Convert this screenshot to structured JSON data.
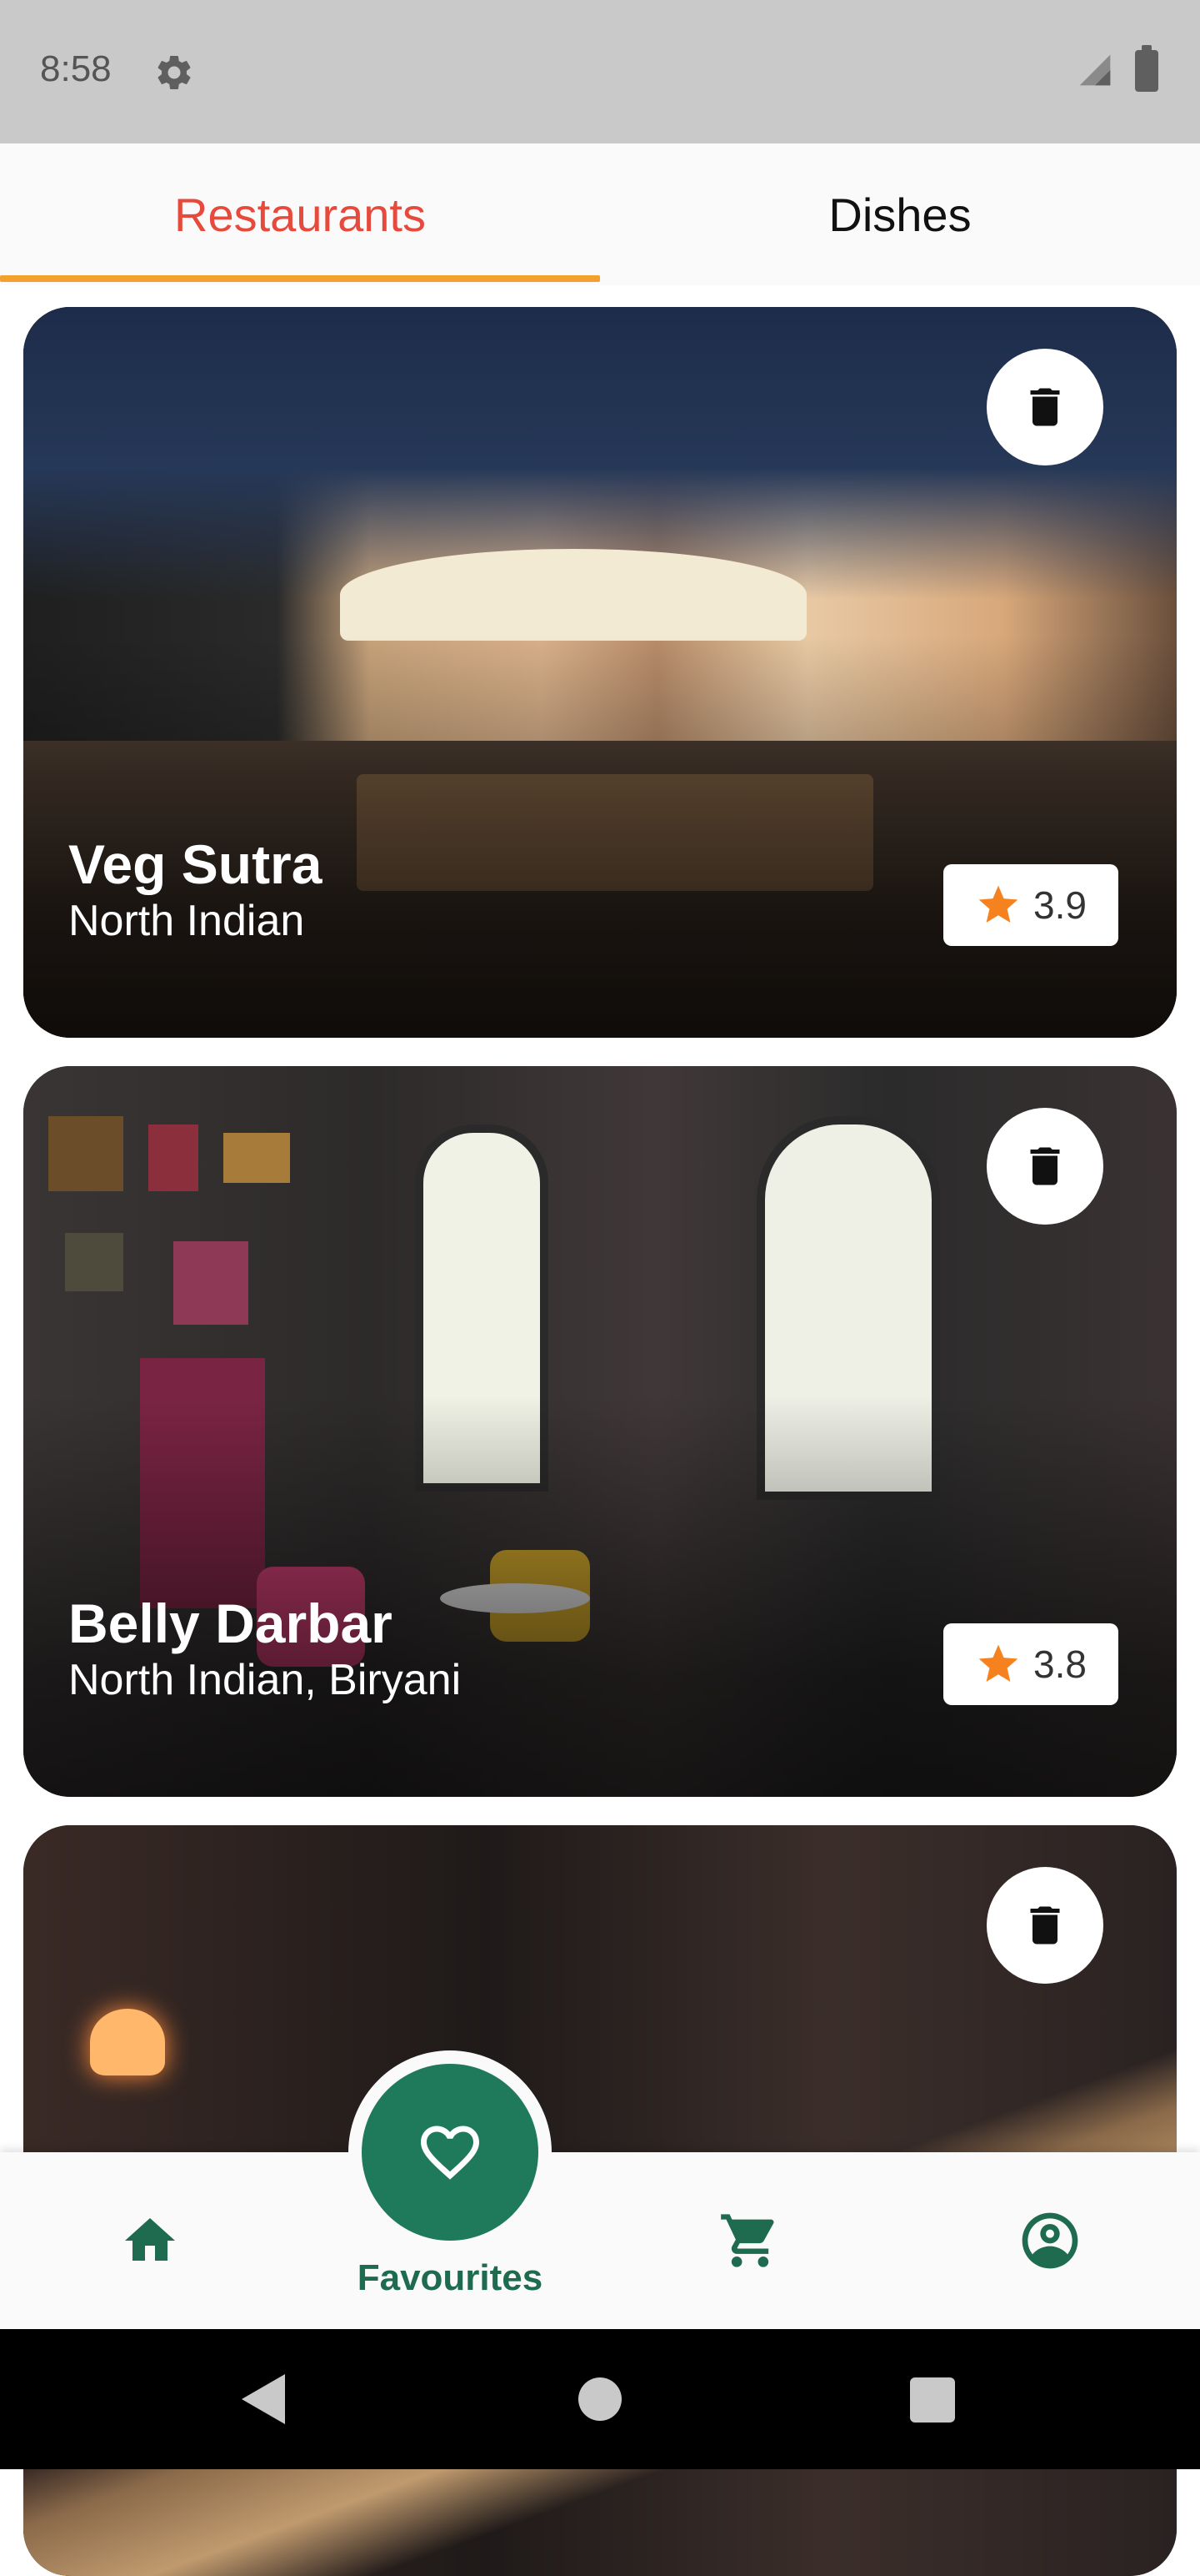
{
  "status_bar": {
    "time": "8:58"
  },
  "tabs": [
    {
      "label": "Restaurants",
      "active": true
    },
    {
      "label": "Dishes",
      "active": false
    }
  ],
  "colors": {
    "active_tab": "#e64a3c",
    "tab_indicator": "#f4a02c",
    "brand_green": "#1f7a5c",
    "star": "#f5821f"
  },
  "restaurants": [
    {
      "name": "Veg Sutra",
      "cuisine": "North Indian",
      "rating": "3.9"
    },
    {
      "name": "Belly Darbar",
      "cuisine": "North Indian, Biryani",
      "rating": "3.8"
    }
  ],
  "bottom_nav": {
    "items": [
      {
        "icon": "home-icon"
      },
      {
        "icon": "heart-icon",
        "label": "Favourites",
        "active": true
      },
      {
        "icon": "cart-icon"
      },
      {
        "icon": "account-icon"
      }
    ]
  }
}
